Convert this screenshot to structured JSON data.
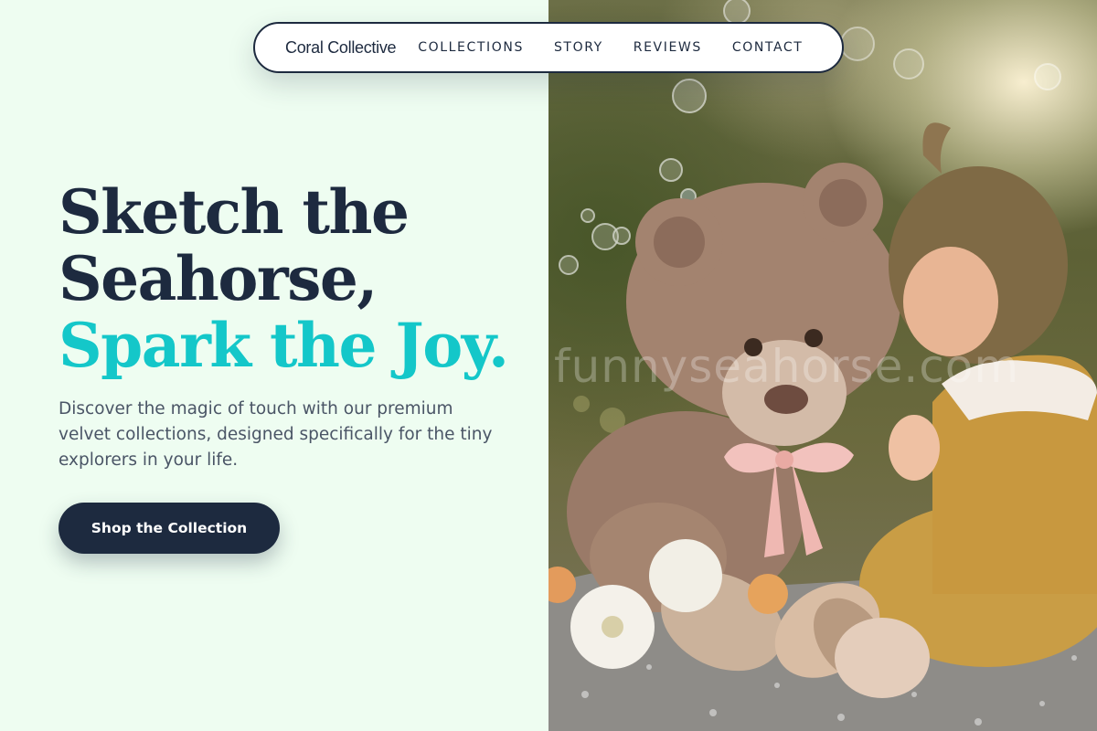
{
  "nav": {
    "brand": "Coral Collective",
    "links": [
      {
        "label": "COLLECTIONS"
      },
      {
        "label": "STORY"
      },
      {
        "label": "REVIEWS"
      },
      {
        "label": "CONTACT"
      }
    ]
  },
  "hero": {
    "headline_line1": "Sketch the",
    "headline_line2": "Seahorse,",
    "headline_accent": "Spark the Joy.",
    "description": "Discover the magic of touch with our premium velvet collections, designed specifically for the tiny explorers in your life.",
    "cta_label": "Shop the Collection"
  },
  "photo": {
    "watermark": "funnyseahorse.com",
    "subject": "teddy-bear-and-toddler-photo"
  },
  "colors": {
    "background": "#eefdf1",
    "navy": "#1d2a3f",
    "accent_teal": "#14c7c9",
    "body_text": "#4a5566"
  }
}
